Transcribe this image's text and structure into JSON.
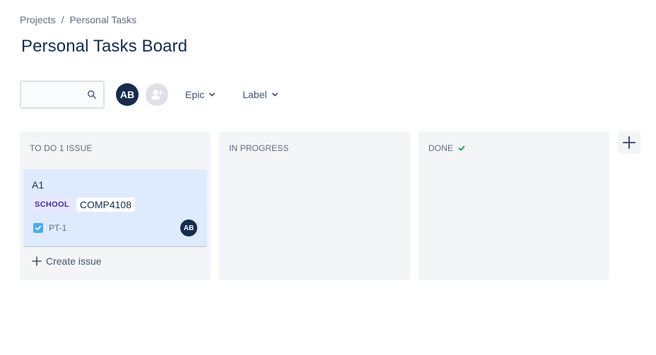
{
  "breadcrumb": {
    "items": [
      "Projects",
      "Personal Tasks"
    ],
    "separator": "/"
  },
  "page_title": "Personal Tasks Board",
  "toolbar": {
    "search_placeholder": "",
    "search_value": "",
    "avatar_initials": "AB",
    "filters": [
      {
        "label": "Epic"
      },
      {
        "label": "Label"
      }
    ]
  },
  "columns": [
    {
      "title": "TO DO 1 ISSUE"
    },
    {
      "title": "IN PROGRESS"
    },
    {
      "title": "DONE"
    }
  ],
  "card": {
    "title": "A1",
    "label_tag": "SCHOOL",
    "label_text": "COMP4108",
    "issue_key": "PT-1",
    "assignee_initials": "AB"
  },
  "create_issue_label": "Create issue",
  "colors": {
    "accent": "#172b4d",
    "card_bg": "#deebff",
    "checkbox": "#4bade8",
    "done_check": "#00875a",
    "column_bg": "#f4f5f7"
  }
}
